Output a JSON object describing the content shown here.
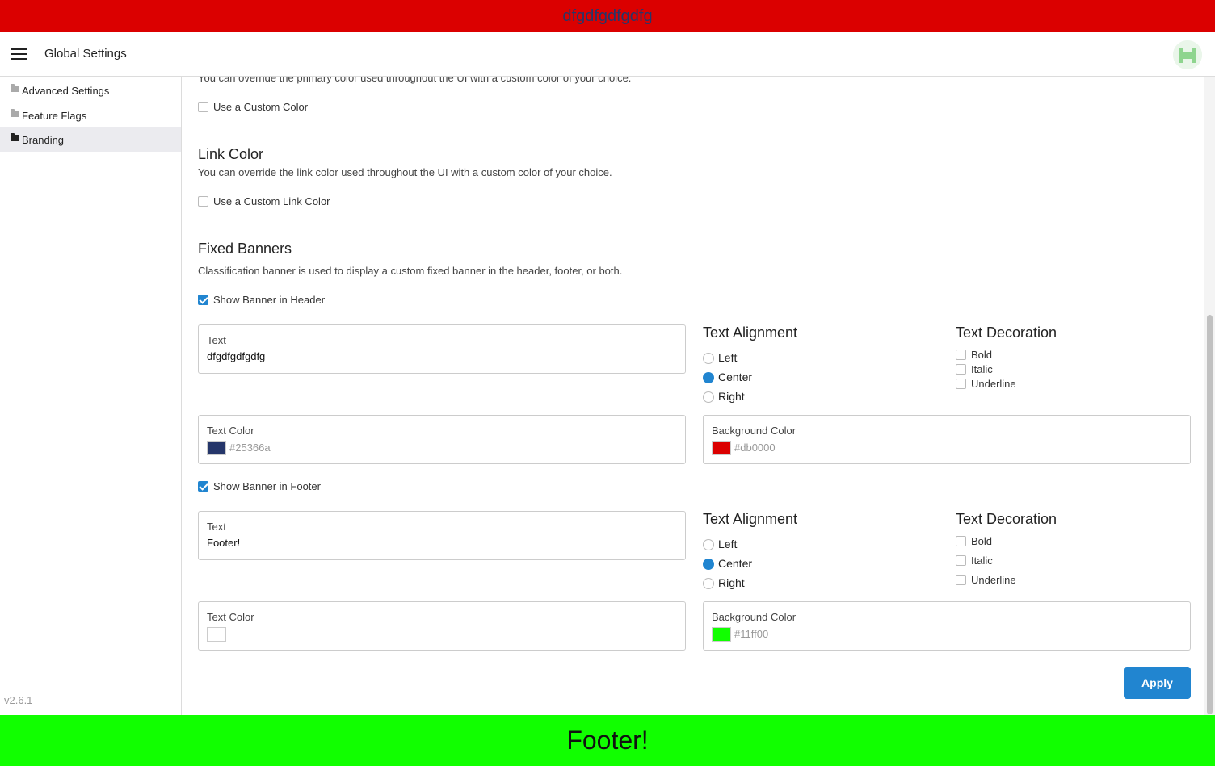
{
  "header_banner": {
    "text": "dfgdfgdfgdfg",
    "color": "#25366a",
    "background": "#db0000"
  },
  "footer_banner": {
    "text": "Footer!",
    "background": "#11ff00"
  },
  "appbar": {
    "title": "Global Settings",
    "menu_icon": "hamburger-icon",
    "avatar_icon": "identicon-avatar"
  },
  "sidebar": {
    "items": [
      {
        "label": "Advanced Settings",
        "icon": "folder-icon",
        "active": false
      },
      {
        "label": "Feature Flags",
        "icon": "folder-icon",
        "active": false
      },
      {
        "label": "Branding",
        "icon": "folder-open-icon",
        "active": true
      }
    ],
    "version": "v2.6.1"
  },
  "primary_color": {
    "description": "You can override the primary color used throughout the UI with a custom color of your choice.",
    "checkbox_label": "Use a Custom Color",
    "checked": false
  },
  "link_color": {
    "title": "Link Color",
    "description": "You can override the link color used throughout the UI with a custom color of your choice.",
    "checkbox_label": "Use a Custom Link Color",
    "checked": false
  },
  "fixed_banners": {
    "title": "Fixed Banners",
    "description": "Classification banner is used to display a custom fixed banner in the header, footer, or both.",
    "header": {
      "checkbox_label": "Show Banner in Header",
      "checked": true,
      "text_label": "Text",
      "text_value": "dfgdfgdfgdfg",
      "alignment_title": "Text Alignment",
      "alignment_options": [
        "Left",
        "Center",
        "Right"
      ],
      "alignment_selected": "Center",
      "decoration_title": "Text Decoration",
      "decoration_options": [
        "Bold",
        "Italic",
        "Underline"
      ],
      "text_color_label": "Text Color",
      "text_color": "#25366a",
      "background_color_label": "Background Color",
      "background_color": "#db0000"
    },
    "footer": {
      "checkbox_label": "Show Banner in Footer",
      "checked": true,
      "text_label": "Text",
      "text_value": "Footer!",
      "alignment_title": "Text Alignment",
      "alignment_options": [
        "Left",
        "Center",
        "Right"
      ],
      "alignment_selected": "Center",
      "decoration_title": "Text Decoration",
      "decoration_options": [
        "Bold",
        "Italic",
        "Underline"
      ],
      "text_color_label": "Text Color",
      "text_color": "",
      "background_color_label": "Background Color",
      "background_color": "#11ff00"
    }
  },
  "apply_label": "Apply",
  "colors": {
    "accent": "#2185d0"
  }
}
